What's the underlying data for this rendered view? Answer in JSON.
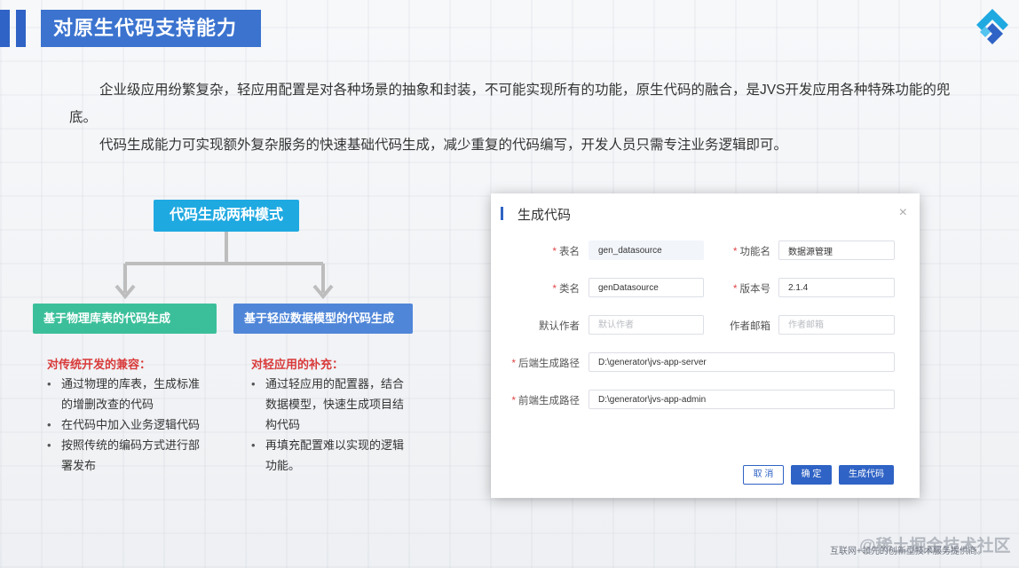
{
  "header": {
    "title": "对原生代码支持能力"
  },
  "intro": {
    "para1": "企业级应用纷繁复杂，轻应用配置是对各种场景的抽象和封装，不可能实现所有的功能，原生代码的融合，是JVS开发应用各种特殊功能的兜底。",
    "para2": "代码生成能力可实现额外复杂服务的快速基础代码生成，减少重复的代码编写，开发人员只需专注业务逻辑即可。"
  },
  "diagram": {
    "root": "代码生成两种模式",
    "left": {
      "title": "基于物理库表的代码生成",
      "heading": "对传统开发的兼容：",
      "items": [
        "通过物理的库表，生成标准的增删改查的代码",
        "在代码中加入业务逻辑代码",
        "按照传统的编码方式进行部署发布"
      ]
    },
    "right": {
      "title": "基于轻应数据模型的代码生成",
      "heading": "对轻应用的补充：",
      "items": [
        "通过轻应用的配置器，结合数据模型，快速生成项目结构代码",
        "再填充配置难以实现的逻辑功能。"
      ]
    }
  },
  "dialog": {
    "title": "生成代码",
    "close": "×",
    "fields": {
      "table_name": {
        "label": "表名",
        "value": "gen_datasource"
      },
      "function_name": {
        "label": "功能名",
        "value": "数据源管理"
      },
      "class_name": {
        "label": "类名",
        "value": "genDatasource"
      },
      "version": {
        "label": "版本号",
        "value": "2.1.4"
      },
      "author": {
        "label": "默认作者",
        "placeholder": "默认作者"
      },
      "email": {
        "label": "作者邮箱",
        "placeholder": "作者邮箱"
      },
      "backend_path": {
        "label": "后端生成路径",
        "value": "D:\\generator\\jvs-app-server"
      },
      "frontend_path": {
        "label": "前端生成路径",
        "value": "D:\\generator\\jvs-app-admin"
      }
    },
    "required_mark": "*",
    "buttons": {
      "cancel": "取 消",
      "ok": "确 定",
      "generate": "生成代码"
    }
  },
  "watermark": {
    "big": "@稀土掘金技术社区",
    "small": "互联网+领先的创新型技术服务提供商。"
  },
  "colors": {
    "primary_blue": "#3b73cf",
    "root_cyan": "#1fa9e1",
    "branch_green": "#3bbf9a",
    "branch_blue": "#4f86d8",
    "heading_red": "#d93a3a"
  }
}
